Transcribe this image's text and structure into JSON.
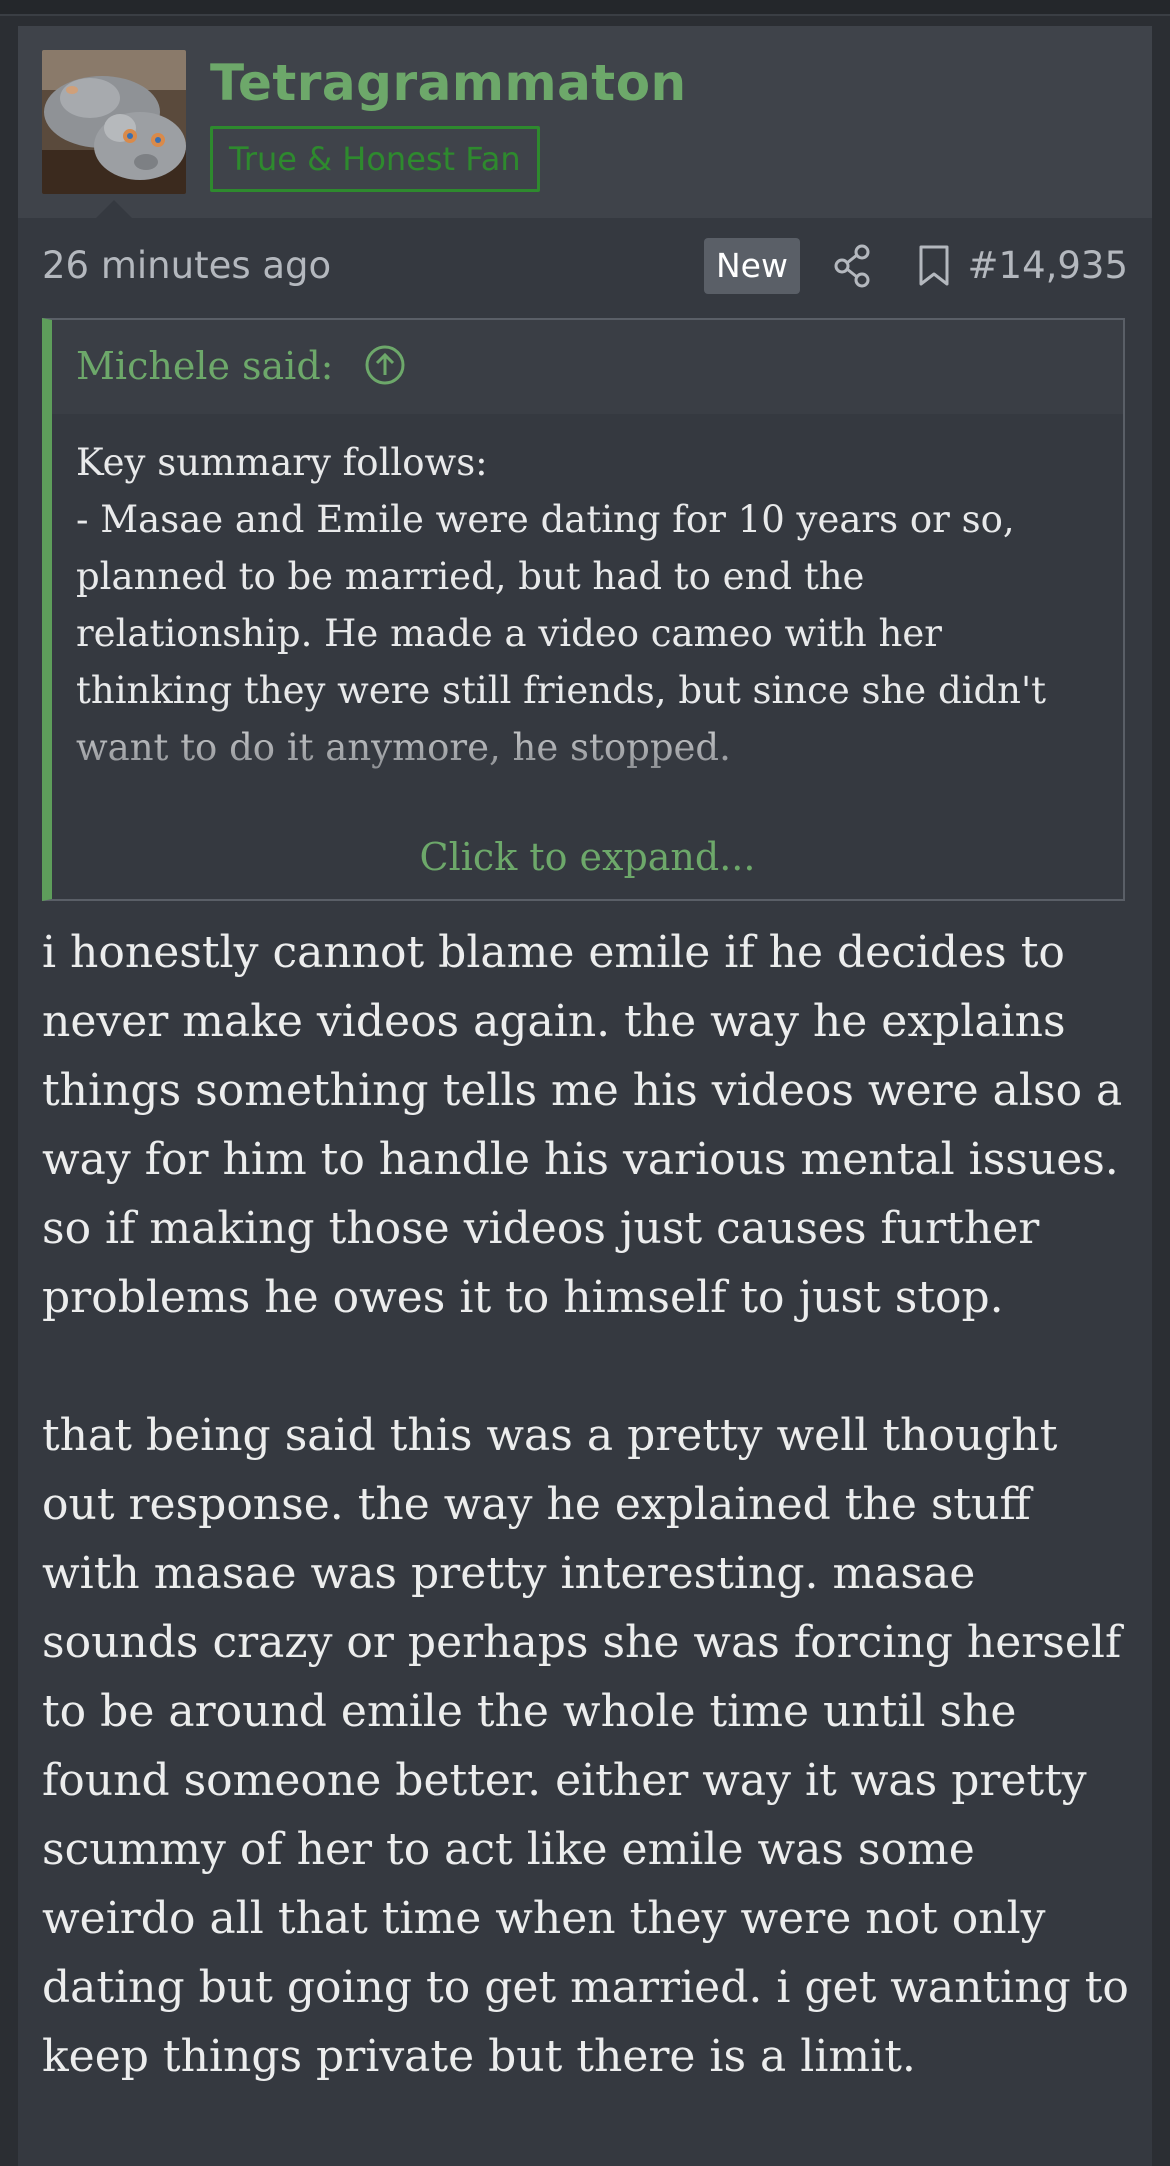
{
  "author": {
    "name": "Tetragrammaton",
    "title": "True & Honest Fan",
    "avatar_icon": "rodent-avatar"
  },
  "meta": {
    "time": "26 minutes ago",
    "badge": "New",
    "share_icon": "share-icon",
    "bookmark_icon": "bookmark-icon",
    "post_number": "#14,935"
  },
  "quote": {
    "author": "Michele said:",
    "jump_icon": "arrow-up-circle-icon",
    "intro": "Key summary follows:",
    "body": "- Masae and Emile were dating for 10 years or so, planned to be married, but had to end the relationship. He made a video cameo with her thinking they were still friends, but since she didn't want to do it anymore, he stopped.",
    "expand_label": "Click to expand..."
  },
  "message": {
    "paragraphs": [
      "i honestly cannot blame emile if he decides to never make videos again. the way he explains things something tells me his videos were also a way for him to handle his various mental issues. so if making those videos just causes further problems he owes it to himself to just stop.",
      "that being said this was a pretty well thought out response. the way he explained the stuff with masae was pretty interesting. masae sounds crazy or perhaps she was forcing herself to be around emile the whole time until she found someone better. either way it was pretty scummy of her to act like emile was some weirdo all that time when they were not only dating but going to get married. i get wanting to keep things private but there is a limit."
    ]
  },
  "colors": {
    "accent_green": "#6da86a",
    "title_green": "#2e8a2e",
    "background": "#353940"
  }
}
